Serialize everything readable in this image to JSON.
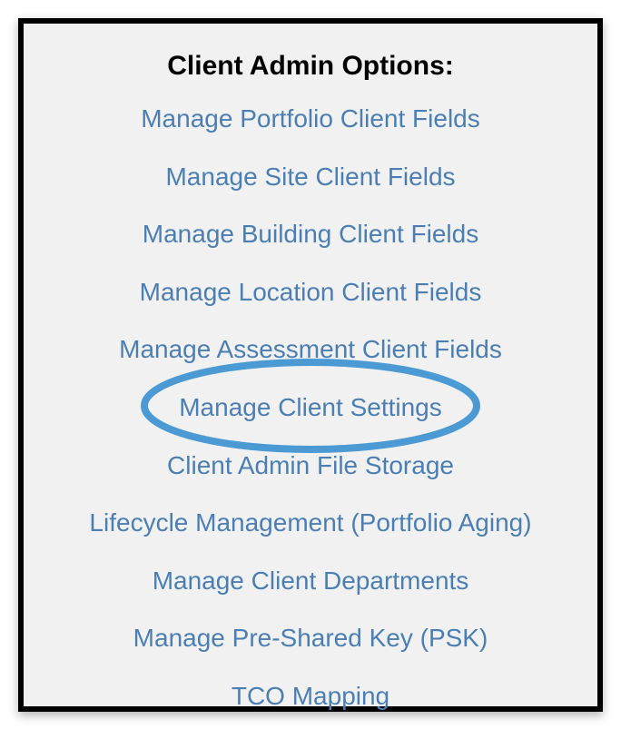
{
  "panel": {
    "heading": "Client Admin Options:",
    "links": [
      {
        "label": "Manage Portfolio Client Fields",
        "highlighted": false
      },
      {
        "label": "Manage Site Client Fields",
        "highlighted": false
      },
      {
        "label": "Manage Building Client Fields",
        "highlighted": false
      },
      {
        "label": "Manage Location Client Fields",
        "highlighted": false
      },
      {
        "label": "Manage Assessment Client Fields",
        "highlighted": false
      },
      {
        "label": "Manage Client Settings",
        "highlighted": true
      },
      {
        "label": "Client Admin File Storage",
        "highlighted": false
      },
      {
        "label": "Lifecycle Management (Portfolio Aging)",
        "highlighted": false
      },
      {
        "label": "Manage Client Departments",
        "highlighted": false
      },
      {
        "label": "Manage Pre-Shared Key (PSK)",
        "highlighted": false
      },
      {
        "label": "TCO Mapping",
        "highlighted": false
      }
    ]
  },
  "annotation": {
    "highlight_color": "#4b9ad4"
  }
}
